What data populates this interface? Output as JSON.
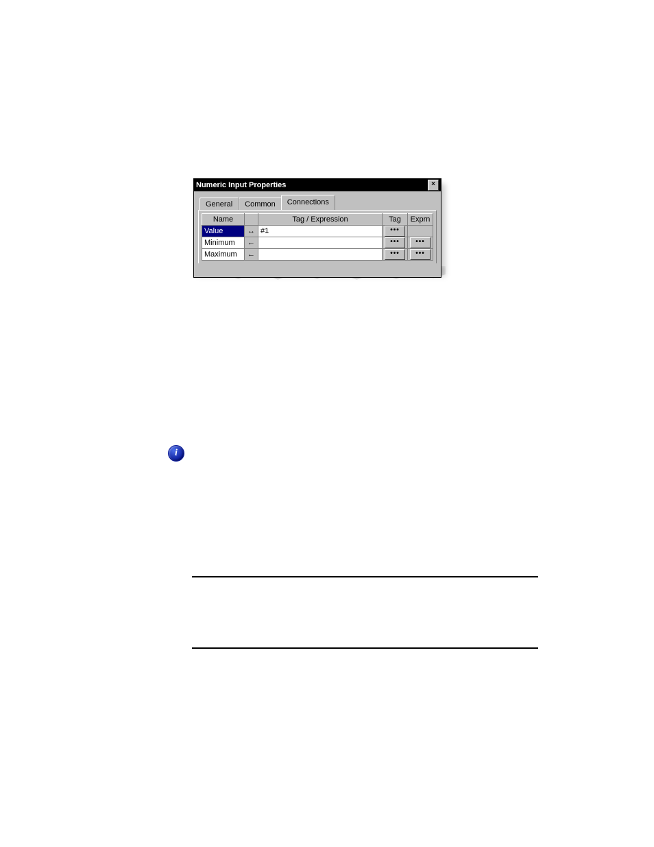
{
  "dialog": {
    "title": "Numeric Input Properties",
    "close_label": "×",
    "tabs": [
      "General",
      "Common",
      "Connections"
    ],
    "active_tab_index": 2,
    "headers": {
      "name": "Name",
      "arrow": "",
      "tagexpr": "Tag / Expression",
      "tag": "Tag",
      "exprn": "Exprn"
    },
    "rows": [
      {
        "name": "Value",
        "arrow": "↔",
        "tagexpr": "#1",
        "tag_btn": "•••",
        "exprn_btn": "",
        "selected": true
      },
      {
        "name": "Minimum",
        "arrow": "←",
        "tagexpr": "",
        "tag_btn": "•••",
        "exprn_btn": "•••",
        "selected": false
      },
      {
        "name": "Maximum",
        "arrow": "←",
        "tagexpr": "",
        "tag_btn": "•••",
        "exprn_btn": "•••",
        "selected": false
      }
    ]
  }
}
